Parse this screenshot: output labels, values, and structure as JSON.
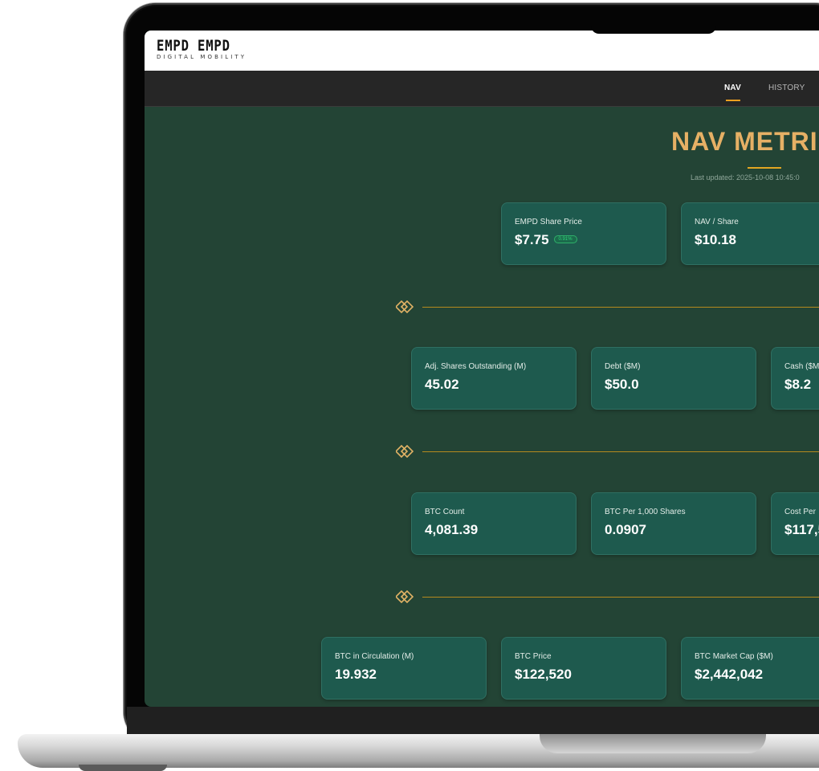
{
  "brand": {
    "name": "EMPD EMPD",
    "subtitle": "DIGITAL MOBILITY"
  },
  "nav": {
    "tabs": [
      {
        "label": "NAV",
        "active": true
      },
      {
        "label": "HISTORY",
        "active": false
      }
    ]
  },
  "main": {
    "title": "NAV METRI",
    "last_updated": "Last updated: 2025-10-08 10:45:0"
  },
  "metrics": {
    "share_price": {
      "label": "EMPD Share Price",
      "value": "$7.75",
      "change": "0.91%"
    },
    "nav_per_share": {
      "label": "NAV / Share",
      "value": "$10.18"
    },
    "adj_shares": {
      "label": "Adj. Shares Outstanding (M)",
      "value": "45.02"
    },
    "debt": {
      "label": "Debt ($M)",
      "value": "$50.0"
    },
    "cash": {
      "label": "Cash ($M",
      "value": "$8.2"
    },
    "btc_count": {
      "label": "BTC Count",
      "value": "4,081.39"
    },
    "btc_per_1000": {
      "label": "BTC Per 1,000 Shares",
      "value": "0.0907"
    },
    "cost_per": {
      "label": "Cost Per",
      "value": "$117,5"
    },
    "btc_circulation": {
      "label": "BTC in Circulation (M)",
      "value": "19.932"
    },
    "btc_price": {
      "label": "BTC Price",
      "value": "$122,520"
    },
    "btc_market_cap": {
      "label": "BTC Market Cap ($M)",
      "value": "$2,442,042"
    }
  },
  "colors": {
    "background": "#234435",
    "card": "#1e5a4e",
    "accent_gold": "#e6b065",
    "positive": "#2fd57a"
  },
  "icons": {
    "divider": "double-diamond-link-icon"
  }
}
